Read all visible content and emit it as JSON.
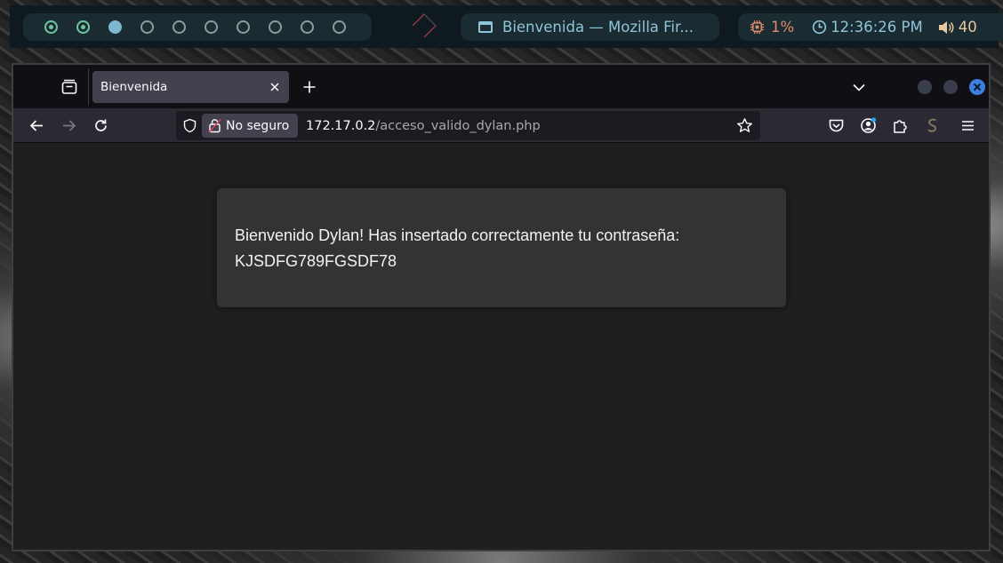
{
  "topbar": {
    "workspaces": [
      {
        "state": "occupied"
      },
      {
        "state": "occupied"
      },
      {
        "state": "active"
      },
      {
        "state": "empty"
      },
      {
        "state": "empty"
      },
      {
        "state": "empty"
      },
      {
        "state": "empty"
      },
      {
        "state": "empty"
      },
      {
        "state": "empty"
      },
      {
        "state": "empty"
      }
    ],
    "window_title": "Bienvenida — Mozilla Fir...",
    "cpu": "1%",
    "clock": "12:36:26 PM",
    "volume": "40",
    "colors": {
      "accent": "#8ec5d8",
      "cpu": "#e08d6b",
      "workspace_occupied": "#6fc7a2"
    }
  },
  "browser": {
    "tab": {
      "title": "Bienvenida"
    },
    "urlbar": {
      "security_label": "No seguro",
      "host": "172.17.0.2",
      "path": "/acceso_valido_dylan.php"
    }
  },
  "page": {
    "message": "Bienvenido Dylan! Has insertado correctamente tu contraseña:",
    "password": "KJSDFG789FGSDF78"
  }
}
